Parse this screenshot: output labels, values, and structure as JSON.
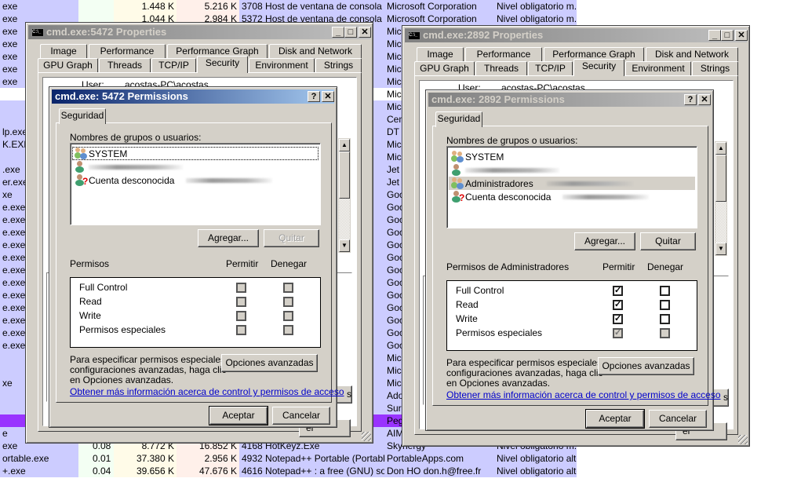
{
  "colors": {
    "name_col": "#ccccff",
    "selected_row": "#9933ff",
    "dialog_face": "#d4d0c8",
    "active_title": "#0a246a",
    "inactive_title": "#808080",
    "link": "#0000cc"
  },
  "process_list": {
    "rows": [
      {
        "name": "exe",
        "private": "1.448 K",
        "working": "5.216 K",
        "desc": "3708 Host de ventana de consola",
        "company": "Microsoft Corporation",
        "integrity": "Nivel obligatorio m..."
      },
      {
        "name": "exe",
        "private": "1.044 K",
        "working": "2.984 K",
        "desc": "5372 Host de ventana de consola",
        "company": "Microsoft Corporation",
        "integrity": "Nivel obligatorio m..."
      },
      {
        "name": "exe",
        "company": "Mic"
      },
      {
        "name": "exe",
        "company": "Mic"
      },
      {
        "name": "exe",
        "company": "Mic"
      },
      {
        "name": "exe",
        "company": "Mic"
      },
      {
        "name": "exe",
        "company": "Mic"
      },
      {
        "name": "",
        "company": "Mic",
        "white": true
      },
      {
        "name": "",
        "company": "Mic"
      },
      {
        "name": "",
        "company": "Cen"
      },
      {
        "name": "lp.exe",
        "company": "DT"
      },
      {
        "name": "K.EXE",
        "company": "Mic"
      },
      {
        "name": "",
        "company": "Mic"
      },
      {
        "name": ".exe",
        "company": "Jet"
      },
      {
        "name": "er.exe",
        "company": "Jet"
      },
      {
        "name": "xe",
        "company": "Goo"
      },
      {
        "name": "e.exe",
        "company": "Goo"
      },
      {
        "name": "e.exe",
        "company": "Goo"
      },
      {
        "name": "e.exe",
        "company": "Goo"
      },
      {
        "name": "e.exe",
        "company": "Goo"
      },
      {
        "name": "e.exe",
        "company": "Goo"
      },
      {
        "name": "e.exe",
        "company": "Goo"
      },
      {
        "name": "e.exe",
        "company": "Goo"
      },
      {
        "name": "e.exe",
        "company": "Goo"
      },
      {
        "name": "e.exe",
        "company": "Goo"
      },
      {
        "name": "e.exe",
        "company": "Goo"
      },
      {
        "name": "e.exe",
        "company": "Goo"
      },
      {
        "name": "e.exe",
        "company": "Goo"
      },
      {
        "name": "",
        "company": "Mic"
      },
      {
        "name": "",
        "company": "Mic"
      },
      {
        "name": "xe",
        "company": "Mic"
      },
      {
        "name": "",
        "company": "Ado"
      },
      {
        "name": "",
        "company": "Sur"
      },
      {
        "name": "",
        "company": "Peg",
        "selected": true
      },
      {
        "name": "e",
        "company": "AIM"
      },
      {
        "name": "exe",
        "cpu": "0.08",
        "private": "8.772 K",
        "working": "16.852 K",
        "desc": "4168 HotKeyz.Exe",
        "company": "Skynergy",
        "integrity": "Nivel obligatorio m..."
      },
      {
        "name": "ortable.exe",
        "cpu": "0.01",
        "private": "37.380 K",
        "working": "2.956 K",
        "desc": "4932 Notepad++ Portable (Portabl...",
        "company": "PortableApps.com",
        "integrity": "Nivel obligatorio alto"
      },
      {
        "name": "+.exe",
        "cpu": "0.04",
        "private": "39.656 K",
        "working": "47.676 K",
        "desc": "4616 Notepad++ : a free (GNU) so...",
        "company": "Don HO don.h@free.fr",
        "integrity": "Nivel obligatorio alto"
      }
    ]
  },
  "dialogs": [
    {
      "properties": {
        "title": "cmd.exe:5472 Properties",
        "icon": "console-icon",
        "tabs_row1": [
          "Image",
          "Performance",
          "Performance Graph",
          "Disk and Network"
        ],
        "tabs_row2": [
          "GPU Graph",
          "Threads",
          "TCP/IP",
          "Security",
          "Environment",
          "Strings"
        ],
        "selected_tab": "Security",
        "user_label": "User:",
        "user_value": "acostas-PC\\acostas",
        "partial_button": "s",
        "partial_cancel": "el"
      },
      "permissions": {
        "title": "cmd.exe: 5472 Permissions",
        "active": true,
        "tab": "Seguridad",
        "groups_label": "Nombres de grupos o usuarios:",
        "groups": [
          {
            "name": "SYSTEM",
            "icon": "group-icon",
            "focused": true
          },
          {
            "name": "",
            "icon": "user-icon",
            "redacted": true
          },
          {
            "name": "Cuenta desconocida",
            "icon": "unknown-user-icon",
            "redacted": true
          }
        ],
        "add_label": "Agregar...",
        "remove_label": "Quitar",
        "remove_enabled": false,
        "perm_label": "Permisos",
        "allow_label": "Permitir",
        "deny_label": "Denegar",
        "perms": [
          {
            "name": "Full Control",
            "allow": "unchecked-disabled",
            "deny": "unchecked-disabled"
          },
          {
            "name": "Read",
            "allow": "unchecked-disabled",
            "deny": "unchecked-disabled"
          },
          {
            "name": "Write",
            "allow": "unchecked-disabled",
            "deny": "unchecked-disabled"
          },
          {
            "name": "Permisos especiales",
            "allow": "unchecked-disabled",
            "deny": "unchecked-disabled"
          }
        ],
        "info_lines": [
          "Para especificar permisos especiales o",
          "configuraciones avanzadas, haga clic",
          "en Opciones avanzadas."
        ],
        "advanced_label": "Opciones avanzadas",
        "link": "Obtener más información acerca de control y permisos de acceso",
        "ok_label": "Aceptar",
        "cancel_label": "Cancelar"
      }
    },
    {
      "properties": {
        "title": "cmd.exe:2892 Properties",
        "icon": "console-icon",
        "tabs_row1": [
          "Image",
          "Performance",
          "Performance Graph",
          "Disk and Network"
        ],
        "tabs_row2": [
          "GPU Graph",
          "Threads",
          "TCP/IP",
          "Security",
          "Environment",
          "Strings"
        ],
        "selected_tab": "Security",
        "user_label": "User:",
        "user_value": "acostas-PC\\acostas",
        "partial_button": "s",
        "partial_cancel": "el"
      },
      "permissions": {
        "title": "cmd.exe: 2892 Permissions",
        "active": false,
        "tab": "Seguridad",
        "groups_label": "Nombres de grupos o usuarios:",
        "groups": [
          {
            "name": "SYSTEM",
            "icon": "group-icon"
          },
          {
            "name": "",
            "icon": "user-icon",
            "redacted": true
          },
          {
            "name": "Administradores",
            "icon": "group-icon",
            "selected": true,
            "redacted": true
          },
          {
            "name": "Cuenta desconocida",
            "icon": "unknown-user-icon",
            "redacted": true
          }
        ],
        "add_label": "Agregar...",
        "remove_label": "Quitar",
        "remove_enabled": true,
        "perm_label": "Permisos de Administradores",
        "allow_label": "Permitir",
        "deny_label": "Denegar",
        "perms": [
          {
            "name": "Full Control",
            "allow": "checked",
            "deny": "unchecked"
          },
          {
            "name": "Read",
            "allow": "checked",
            "deny": "unchecked"
          },
          {
            "name": "Write",
            "allow": "checked",
            "deny": "unchecked"
          },
          {
            "name": "Permisos especiales",
            "allow": "checked-disabled",
            "deny": "unchecked-disabled"
          }
        ],
        "info_lines": [
          "Para especificar permisos especiales o",
          "configuraciones avanzadas, haga clic",
          "en Opciones avanzadas."
        ],
        "advanced_label": "Opciones avanzadas",
        "link": "Obtener más información acerca de control y permisos de acceso",
        "ok_label": "Aceptar",
        "cancel_label": "Cancelar"
      }
    }
  ]
}
